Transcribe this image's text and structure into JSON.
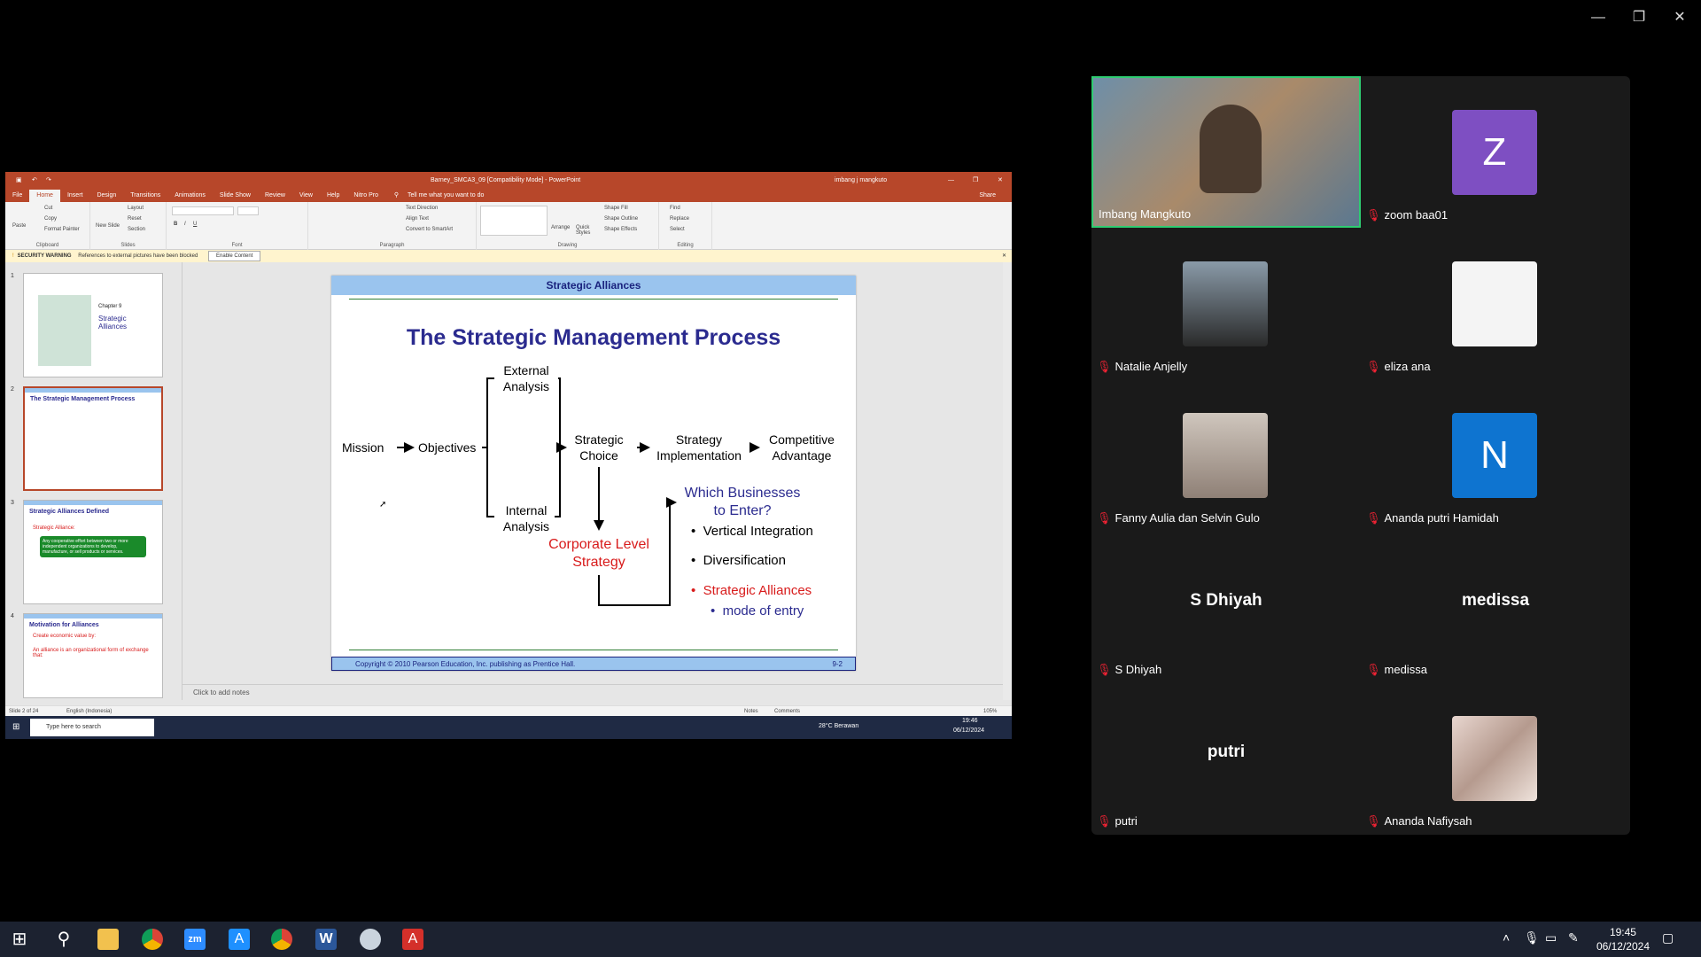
{
  "window_controls": {
    "minimize": "—",
    "restore": "❐",
    "close": "✕"
  },
  "ppt": {
    "title_bar": "Barney_SMCA3_09 [Compatibility Mode] - PowerPoint",
    "user": "imbang j mangkuto",
    "tell_me": "Tell me what you want to do",
    "share": "Share",
    "menu": [
      "File",
      "Home",
      "Insert",
      "Design",
      "Transitions",
      "Animations",
      "Slide Show",
      "Review",
      "View",
      "Help",
      "Nitro Pro"
    ],
    "ribbon": {
      "clipboard": {
        "label": "Clipboard",
        "paste": "Paste",
        "cut": "Cut",
        "copy": "Copy",
        "format_painter": "Format Painter"
      },
      "slides": {
        "label": "Slides",
        "new_slide": "New Slide",
        "layout": "Layout",
        "reset": "Reset",
        "section": "Section"
      },
      "font": {
        "label": "Font"
      },
      "paragraph": {
        "label": "Paragraph",
        "text_direction": "Text Direction",
        "align_text": "Align Text",
        "convert": "Convert to SmartArt"
      },
      "drawing": {
        "label": "Drawing",
        "arrange": "Arrange",
        "quick_styles": "Quick Styles",
        "shape_fill": "Shape Fill",
        "shape_outline": "Shape Outline",
        "shape_effects": "Shape Effects"
      },
      "editing": {
        "label": "Editing",
        "find": "Find",
        "replace": "Replace",
        "select": "Select"
      }
    },
    "security_warning": {
      "label": "SECURITY WARNING",
      "text": "References to external pictures have been blocked",
      "button": "Enable Content"
    },
    "thumbnails": [
      {
        "num": "1",
        "chapter": "Chapter 9",
        "title": "Strategic Alliances"
      },
      {
        "num": "2",
        "title": "The Strategic Management Process"
      },
      {
        "num": "3",
        "title": "Strategic Alliances Defined",
        "sub": "Strategic Alliance:",
        "box": "Any cooperative effort between two or more independent organizations to develop, manufacture, or sell products or services."
      },
      {
        "num": "4",
        "title": "Motivation for Alliances",
        "line1": "Create economic value by:",
        "line2": "An alliance is an organizational form of exchange that:"
      }
    ],
    "slide": {
      "header": "Strategic Alliances",
      "title": "The Strategic Management Process",
      "nodes": {
        "mission": "Mission",
        "objectives": "Objectives",
        "external": "External\nAnalysis",
        "internal": "Internal\nAnalysis",
        "choice": "Strategic\nChoice",
        "implementation": "Strategy\nImplementation",
        "advantage": "Competitive\nAdvantage",
        "corporate": "Corporate Level\nStrategy",
        "which": "Which Businesses\nto Enter?"
      },
      "bullets": [
        "Vertical Integration",
        "Diversification"
      ],
      "red_bullet": "Strategic Alliances",
      "sub_bullet": "mode of entry",
      "footer": "Copyright © 2010 Pearson Education, Inc. publishing as Prentice Hall.",
      "page": "9-2"
    },
    "notes_placeholder": "Click to add notes",
    "status": {
      "slide": "Slide 2 of 24",
      "language": "English (Indonesia)",
      "notes": "Notes",
      "comments": "Comments",
      "zoom": "105%"
    },
    "inner_taskbar": {
      "search": "Type here to search",
      "weather": "28°C  Berawan",
      "time": "19:46",
      "date": "06/12/2024"
    }
  },
  "participants": [
    {
      "name": "Imbang Mangkuto",
      "type": "video",
      "muted": false
    },
    {
      "name": "zoom baa01",
      "type": "initial",
      "initial": "Z",
      "color": "#7e4fc2",
      "muted": true
    },
    {
      "name": "Natalie Anjelly",
      "type": "photo",
      "muted": true
    },
    {
      "name": "eliza ana",
      "type": "photo",
      "muted": true
    },
    {
      "name": "Fanny Aulia dan Selvin Gulo",
      "type": "photo",
      "muted": true
    },
    {
      "name": "Ananda putri Hamidah",
      "type": "initial",
      "initial": "N",
      "color": "#0e74d0",
      "muted": true
    },
    {
      "name": "S Dhiyah",
      "display": "S Dhiyah",
      "type": "text",
      "muted": true
    },
    {
      "name": "medissa",
      "display": "medissa",
      "type": "text",
      "muted": true
    },
    {
      "name": "putri",
      "display": "putri",
      "type": "text",
      "muted": true
    },
    {
      "name": "Ananda Nafiysah",
      "type": "photo",
      "muted": true
    }
  ],
  "taskbar": {
    "time": "19:45",
    "date": "06/12/2024"
  }
}
